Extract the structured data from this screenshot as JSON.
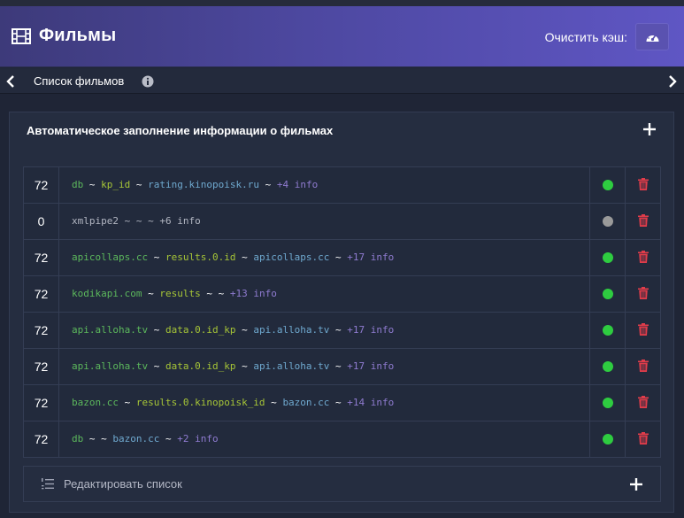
{
  "header": {
    "title": "Фильмы",
    "clear_cache_label": "Очистить кэш:",
    "clear_cache_icon": "dashboard-icon"
  },
  "subbar": {
    "breadcrumb": "Список фильмов"
  },
  "panel": {
    "title": "Автоматическое заполнение информации о фильмах"
  },
  "rows": [
    {
      "num": "72",
      "parts": [
        [
          "db",
          "green"
        ],
        [
          " ~ ",
          "white"
        ],
        [
          "kp_id",
          "lime"
        ],
        [
          " ~ ",
          "white"
        ],
        [
          "rating.kinopoisk.ru",
          "blue"
        ],
        [
          " ~ ",
          "white"
        ],
        [
          "+4 info",
          "purple"
        ]
      ],
      "status": "active"
    },
    {
      "num": "0",
      "parts": [
        [
          "xmlpipe2 ~ ~ ~ +6 info",
          "gray"
        ]
      ],
      "status": "inactive"
    },
    {
      "num": "72",
      "parts": [
        [
          "apicollaps.cc",
          "green"
        ],
        [
          " ~ ",
          "white"
        ],
        [
          "results.0.id",
          "lime"
        ],
        [
          " ~ ",
          "white"
        ],
        [
          "apicollaps.cc",
          "blue"
        ],
        [
          " ~ ",
          "white"
        ],
        [
          "+17 info",
          "purple"
        ]
      ],
      "status": "active"
    },
    {
      "num": "72",
      "parts": [
        [
          "kodikapi.com",
          "green"
        ],
        [
          " ~ ",
          "white"
        ],
        [
          "results",
          "lime"
        ],
        [
          " ~ ~ ",
          "white"
        ],
        [
          "+13 info",
          "purple"
        ]
      ],
      "status": "active"
    },
    {
      "num": "72",
      "parts": [
        [
          "api.alloha.tv",
          "green"
        ],
        [
          " ~ ",
          "white"
        ],
        [
          "data.0.id_kp",
          "lime"
        ],
        [
          " ~ ",
          "white"
        ],
        [
          "api.alloha.tv",
          "blue"
        ],
        [
          " ~ ",
          "white"
        ],
        [
          "+17 info",
          "purple"
        ]
      ],
      "status": "active"
    },
    {
      "num": "72",
      "parts": [
        [
          "api.alloha.tv",
          "green"
        ],
        [
          " ~ ",
          "white"
        ],
        [
          "data.0.id_kp",
          "lime"
        ],
        [
          " ~ ",
          "white"
        ],
        [
          "api.alloha.tv",
          "blue"
        ],
        [
          " ~ ",
          "white"
        ],
        [
          "+17 info",
          "purple"
        ]
      ],
      "status": "active"
    },
    {
      "num": "72",
      "parts": [
        [
          "bazon.cc",
          "green"
        ],
        [
          " ~ ",
          "white"
        ],
        [
          "results.0.kinopoisk_id",
          "lime"
        ],
        [
          " ~ ",
          "white"
        ],
        [
          "bazon.cc",
          "blue"
        ],
        [
          " ~ ",
          "white"
        ],
        [
          "+14 info",
          "purple"
        ]
      ],
      "status": "active"
    },
    {
      "num": "72",
      "parts": [
        [
          "db",
          "green"
        ],
        [
          " ~ ~ ",
          "white"
        ],
        [
          "bazon.cc",
          "blue"
        ],
        [
          " ~ ",
          "white"
        ],
        [
          "+2 info",
          "purple"
        ]
      ],
      "status": "active"
    }
  ],
  "edit": {
    "label": "Редактировать список"
  },
  "colors": {
    "status_active": "#2ecc40",
    "status_inactive": "#9a9a9a",
    "delete": "#e03c4a"
  }
}
